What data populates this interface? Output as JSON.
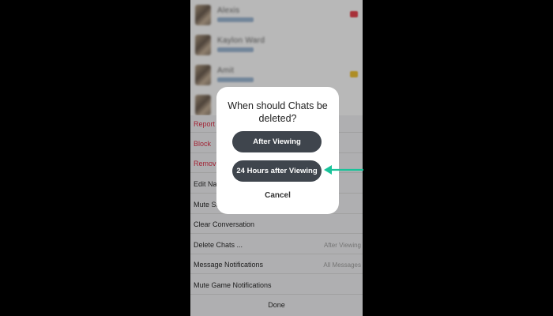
{
  "chat_list": {
    "rows": [
      {
        "name": "Alexis",
        "badge_color": "#e8434f"
      },
      {
        "name": "Kaylon Ward",
        "badge_color": ""
      },
      {
        "name": "Amit",
        "badge_color": "#f2c432"
      }
    ]
  },
  "menu": {
    "items": [
      {
        "label": "Report",
        "style": "red",
        "value": ""
      },
      {
        "label": "Block",
        "style": "red",
        "value": ""
      },
      {
        "label": "Remove",
        "style": "red",
        "value": ""
      },
      {
        "label": "Edit Name",
        "style": "normal",
        "value": ""
      },
      {
        "label": "Mute Story",
        "style": "normal",
        "value": ""
      },
      {
        "label": "Clear Conversation",
        "style": "normal",
        "value": ""
      },
      {
        "label": "Delete Chats ...",
        "style": "normal",
        "value": "After Viewing"
      },
      {
        "label": "Message Notifications",
        "style": "normal",
        "value": "All Messages"
      },
      {
        "label": "Mute Game Notifications",
        "style": "normal",
        "value": ""
      }
    ],
    "done_label": "Done"
  },
  "dialog": {
    "title": "When should Chats be deleted?",
    "option_1": "After Viewing",
    "option_2": "24 Hours after Viewing",
    "cancel_label": "Cancel"
  },
  "colors": {
    "destructive": "#e0324a",
    "dialog_button": "#3f454d",
    "annotation_arrow": "#19c39a"
  },
  "icons": {
    "arrow": "arrow-left-icon"
  }
}
